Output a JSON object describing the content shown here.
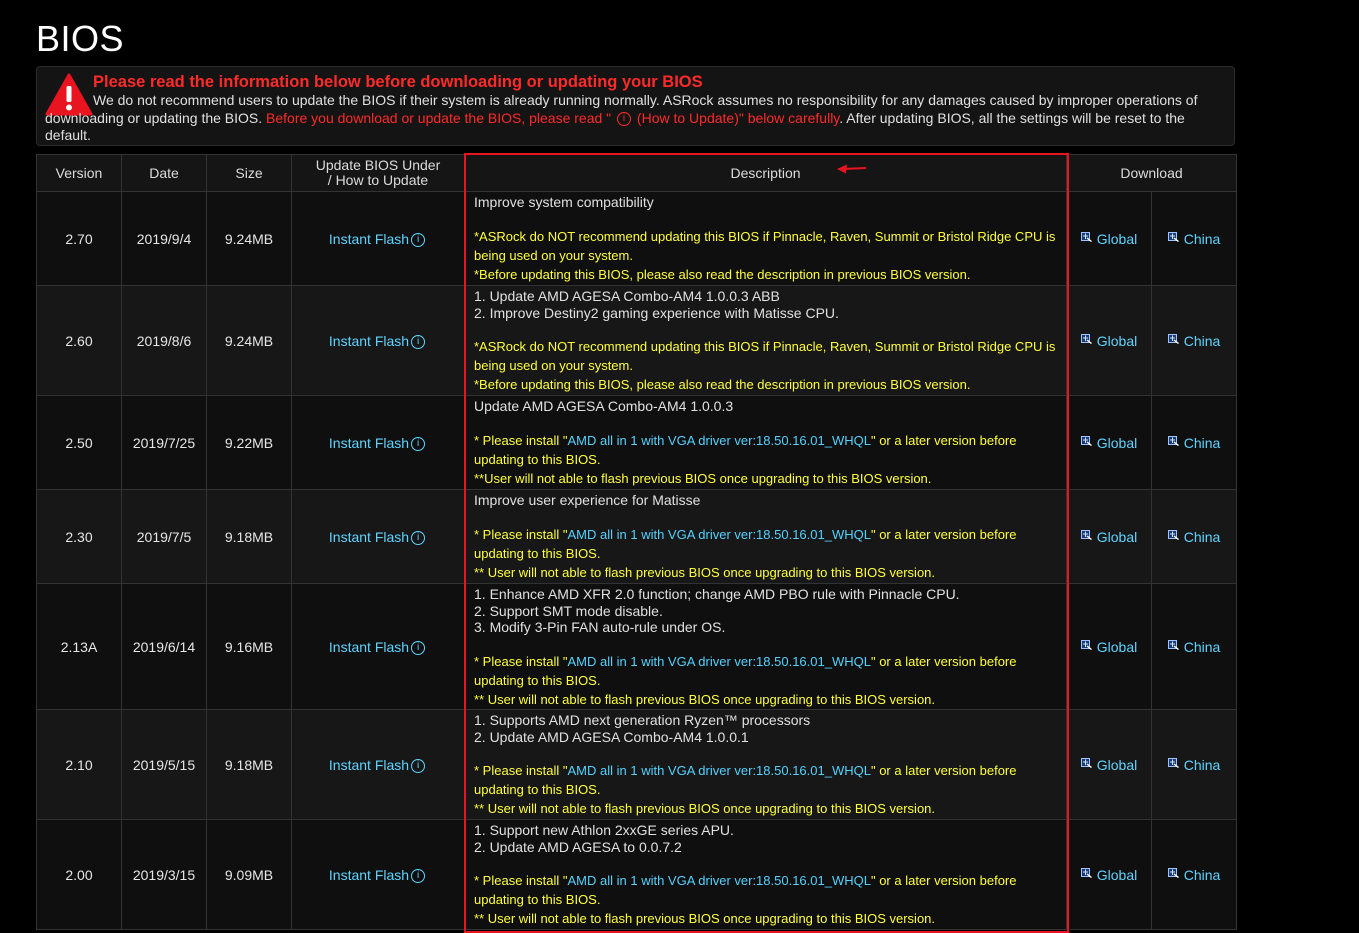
{
  "page": {
    "title": "BIOS"
  },
  "notice": {
    "title": "Please read the information below before downloading or updating your BIOS",
    "text_before": "We do not recommend users to update the BIOS if their system is already running normally. ASRock assumes no responsibility for any damages caused by improper operations of downloading or updating the BIOS. ",
    "red_text_a": "Before you download or update the BIOS, please read \" ",
    "red_text_b": " (How to Update)\" below carefully",
    "text_after": ". After updating BIOS, all the settings will be reset to the default.",
    "info_glyph": "i",
    "colors": {
      "warning": "#ff2a2a",
      "background": "#141414"
    }
  },
  "table": {
    "headers": {
      "version": "Version",
      "date": "Date",
      "size": "Size",
      "update_a": "Update BIOS Under",
      "update_b": "/ How to Update",
      "description": "Description",
      "download": "Download"
    },
    "info_glyph": "i",
    "rows": [
      {
        "version": "2.70",
        "date": "2019/9/4",
        "size": "9.24MB",
        "update": "Instant Flash",
        "desc_lines": [
          "Improve system compatibility"
        ],
        "notes": [
          {
            "a": "*ASRock do NOT recommend updating this BIOS if Pinnacle, Raven, Summit or Bristol Ridge CPU is being used on your system.",
            "link": "",
            "b": ""
          },
          {
            "a": "*Before updating this BIOS, please also read the description in previous BIOS version.",
            "link": "",
            "b": ""
          }
        ],
        "dl_global": "Global",
        "dl_china": "China"
      },
      {
        "version": "2.60",
        "date": "2019/8/6",
        "size": "9.24MB",
        "update": "Instant Flash",
        "desc_lines": [
          "1. Update AMD AGESA Combo-AM4 1.0.0.3 ABB",
          "2. Improve Destiny2 gaming experience with Matisse CPU."
        ],
        "notes": [
          {
            "a": "*ASRock do NOT recommend updating this BIOS if Pinnacle, Raven, Summit or Bristol Ridge CPU is being used on your system.",
            "link": "",
            "b": ""
          },
          {
            "a": "*Before updating this BIOS, please also read the description in previous BIOS version.",
            "link": "",
            "b": ""
          }
        ],
        "dl_global": "Global",
        "dl_china": "China"
      },
      {
        "version": "2.50",
        "date": "2019/7/25",
        "size": "9.22MB",
        "update": "Instant Flash",
        "desc_lines": [
          "Update AMD AGESA Combo-AM4 1.0.0.3"
        ],
        "notes": [
          {
            "a": "* Please install \"",
            "link": "AMD all in 1 with VGA driver ver:18.50.16.01_WHQL",
            "b": "\" or a later version before updating to this BIOS."
          },
          {
            "a": "**User will not able to flash previous BIOS once upgrading to this BIOS version.",
            "link": "",
            "b": ""
          }
        ],
        "dl_global": "Global",
        "dl_china": "China"
      },
      {
        "version": "2.30",
        "date": "2019/7/5",
        "size": "9.18MB",
        "update": "Instant Flash",
        "desc_lines": [
          "Improve user experience for Matisse"
        ],
        "notes": [
          {
            "a": "* Please install \"",
            "link": "AMD all in 1 with VGA driver ver:18.50.16.01_WHQL",
            "b": "\" or a later version before updating to this BIOS."
          },
          {
            "a": "** User will not able to flash previous BIOS once upgrading to this BIOS version.",
            "link": "",
            "b": ""
          }
        ],
        "dl_global": "Global",
        "dl_china": "China"
      },
      {
        "version": "2.13A",
        "date": "2019/6/14",
        "size": "9.16MB",
        "update": "Instant Flash",
        "desc_lines": [
          "1. Enhance AMD XFR 2.0 function; change AMD PBO rule with Pinnacle CPU.",
          "2. Support SMT mode disable.",
          "3. Modify 3-Pin FAN auto-rule under OS."
        ],
        "notes": [
          {
            "a": "* Please install \"",
            "link": "AMD all in 1 with VGA driver ver:18.50.16.01_WHQL",
            "b": "\" or a later version before updating to this BIOS."
          },
          {
            "a": "** User will not able to flash previous BIOS once upgrading to this BIOS version.",
            "link": "",
            "b": ""
          }
        ],
        "dl_global": "Global",
        "dl_china": "China"
      },
      {
        "version": "2.10",
        "date": "2019/5/15",
        "size": "9.18MB",
        "update": "Instant Flash",
        "desc_lines": [
          "1. Supports AMD next generation Ryzen™ processors",
          "2. Update AMD AGESA Combo-AM4 1.0.0.1"
        ],
        "notes": [
          {
            "a": "* Please install \"",
            "link": "AMD all in 1 with VGA driver ver:18.50.16.01_WHQL",
            "b": "\" or a later version before updating to this BIOS."
          },
          {
            "a": "** User will not able to flash previous BIOS once upgrading to this BIOS version.",
            "link": "",
            "b": ""
          }
        ],
        "dl_global": "Global",
        "dl_china": "China"
      },
      {
        "version": "2.00",
        "date": "2019/3/15",
        "size": "9.09MB",
        "update": "Instant Flash",
        "desc_lines": [
          "1. Support new Athlon 2xxGE series APU.",
          "2. Update AMD AGESA to 0.0.7.2"
        ],
        "notes": [
          {
            "a": "* Please install \"",
            "link": "AMD all in 1 with VGA driver ver:18.50.16.01_WHQL",
            "b": "\" or a later version before updating to this BIOS."
          },
          {
            "a": "** User will not able to flash previous BIOS once upgrading to this BIOS version.",
            "link": "",
            "b": ""
          }
        ],
        "dl_global": "Global",
        "dl_china": "China"
      }
    ]
  },
  "colors": {
    "link": "#5fd4ff",
    "note": "#ffff3c",
    "highlight": "#e8141f"
  },
  "icons": [
    "warning-triangle-icon",
    "info-icon",
    "download-globe-icon",
    "arrow-left-icon"
  ]
}
